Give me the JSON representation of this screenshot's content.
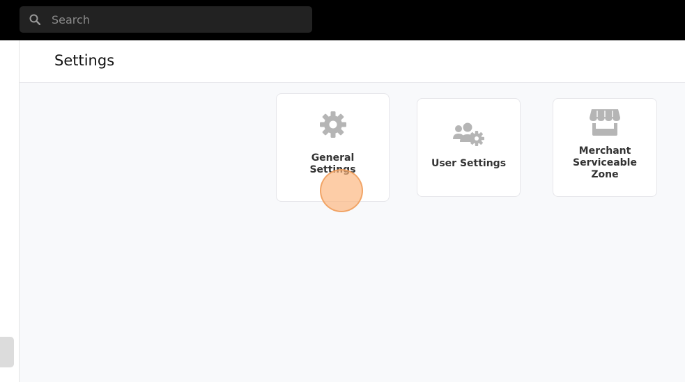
{
  "search": {
    "placeholder": "Search",
    "value": "",
    "icon": "search-icon"
  },
  "header": {
    "title": "Settings"
  },
  "cards": [
    {
      "label": "General\nSettings",
      "icon": "gear-icon"
    },
    {
      "label": "User Settings",
      "icon": "users-gear-icon"
    },
    {
      "label": "Merchant\nServiceable\nZone",
      "icon": "store-icon"
    }
  ],
  "colors": {
    "topbar": "#000000",
    "search_bg": "#222222",
    "icon_gray": "#b5b5b5",
    "content_bg": "#f8f9fb",
    "click_indicator": "#fcb278"
  }
}
